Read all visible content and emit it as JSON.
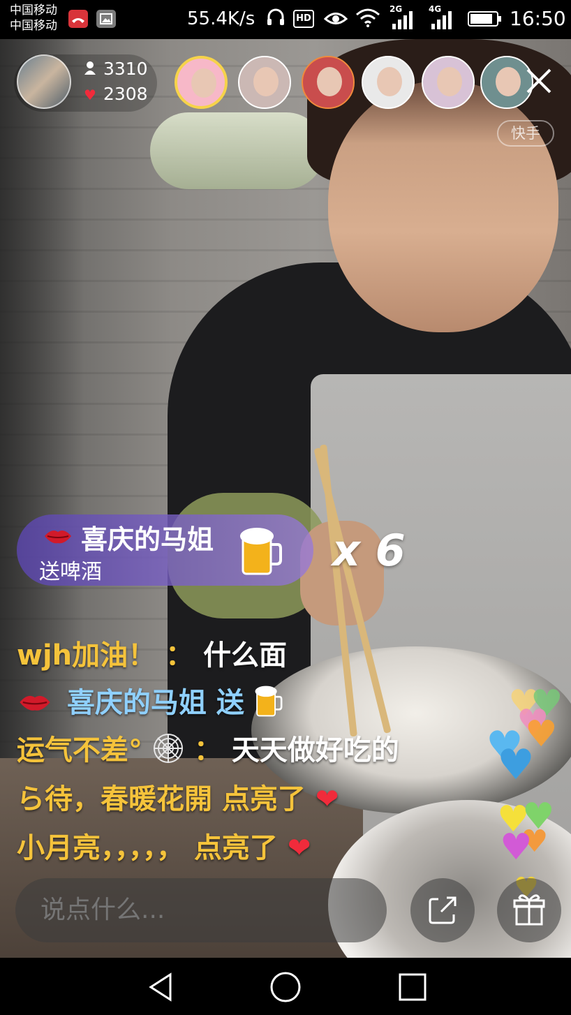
{
  "status_bar": {
    "carrier_1": "中国移动",
    "carrier_2": "中国移动",
    "net_speed": "55.4K/s",
    "hd_label": "HD",
    "signal_1_label": "2G",
    "signal_2_label": "4G",
    "battery_level": 0.85,
    "time": "16:50",
    "icons": [
      "missed-call-icon",
      "gallery-icon",
      "headphones-icon",
      "hd-icon",
      "eye-icon",
      "wifi-icon",
      "signal-icon",
      "battery-icon"
    ]
  },
  "live_header": {
    "viewer_count": "3310",
    "like_count": "2308",
    "watermark": "快手",
    "viewer_avatars": [
      {
        "name": "viewer-avatar-1",
        "bg": "#f7b8c8",
        "border": "#f6d34a"
      },
      {
        "name": "viewer-avatar-2",
        "bg": "#cbb8b4",
        "border": "#ffffff"
      },
      {
        "name": "viewer-avatar-3",
        "bg": "#c94d4d",
        "border": "#f08a3c"
      },
      {
        "name": "viewer-avatar-4",
        "bg": "#e9e9e9",
        "border": "#ffffff"
      },
      {
        "name": "viewer-avatar-5",
        "bg": "#d8c2d6",
        "border": "#ffffff"
      },
      {
        "name": "viewer-avatar-6",
        "bg": "#6f8f8f",
        "border": "#ffffff"
      }
    ]
  },
  "gift_banner": {
    "sender": "喜庆的马姐",
    "action": "送啤酒",
    "combo": "x 6"
  },
  "comments": [
    {
      "user": "wjh加油！",
      "sep": "：",
      "text": "什么面"
    },
    {
      "user": "喜庆的马姐",
      "text": "送"
    },
    {
      "user": "运气不差°",
      "sep": "：",
      "text": "天天做好吃的"
    },
    {
      "user": "ら待，春暖花開",
      "text": "点亮了"
    },
    {
      "user": "小月亮，，，，，",
      "text": "点亮了"
    }
  ],
  "input": {
    "placeholder": "说点什么..."
  },
  "colors": {
    "gift_banner": "#6a52c0",
    "username": "#f5c33b",
    "gift_username": "#8fd0ff",
    "heart": "#f12b3b"
  }
}
